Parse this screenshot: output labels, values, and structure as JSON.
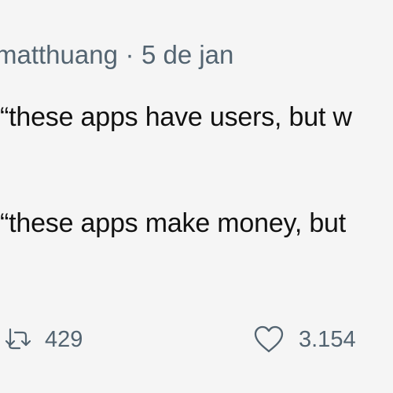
{
  "tweet": {
    "handle": "matthuang",
    "separator": "·",
    "date": "5 de jan",
    "lines": [
      "“these apps have users, but w",
      "“these apps make money, but"
    ]
  },
  "actions": {
    "retweet": {
      "icon": "retweet-icon",
      "count": "429"
    },
    "like": {
      "icon": "heart-icon",
      "count": "3.154"
    }
  },
  "colors": {
    "background": "#f5f5f5",
    "text": "#111111",
    "muted": "#536471"
  }
}
